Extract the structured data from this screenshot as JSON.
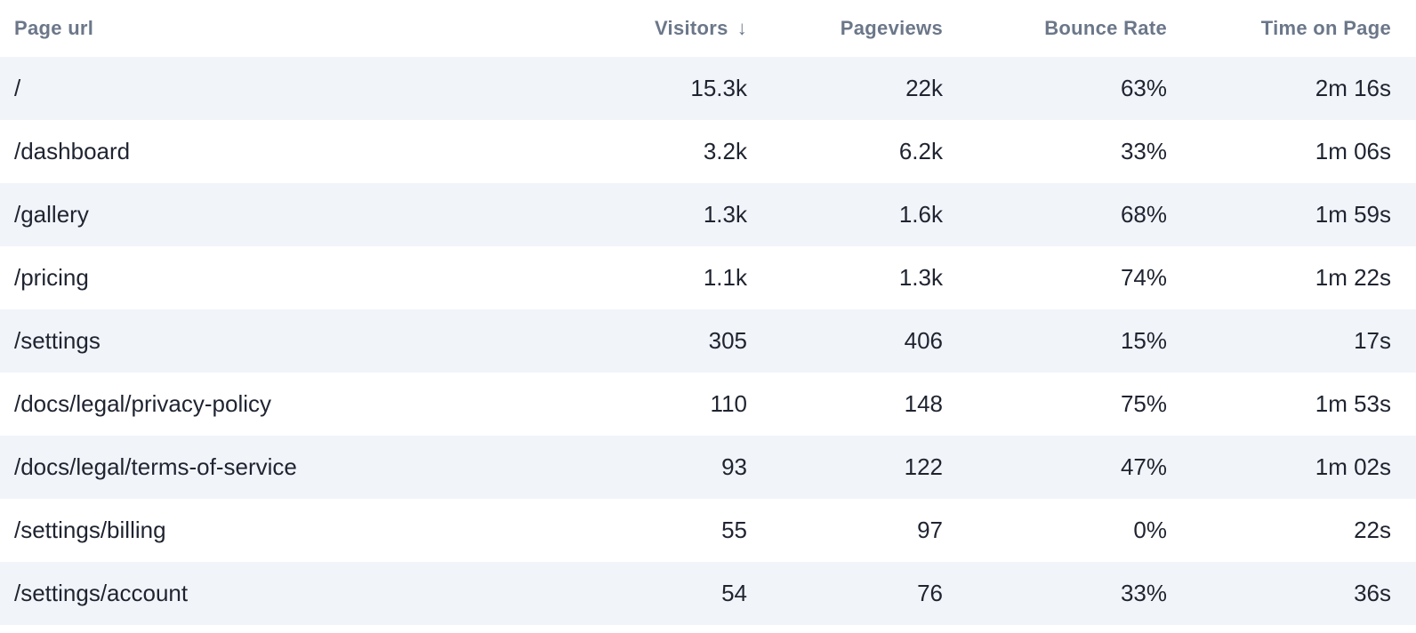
{
  "table": {
    "headers": {
      "page_url": "Page url",
      "visitors": "Visitors",
      "visitors_sort_icon": "↓",
      "pageviews": "Pageviews",
      "bounce_rate": "Bounce Rate",
      "time_on_page": "Time on Page"
    },
    "rows": [
      {
        "url": "/",
        "visitors": "15.3k",
        "pageviews": "22k",
        "bounce_rate": "63%",
        "time_on_page": "2m 16s"
      },
      {
        "url": "/dashboard",
        "visitors": "3.2k",
        "pageviews": "6.2k",
        "bounce_rate": "33%",
        "time_on_page": "1m 06s"
      },
      {
        "url": "/gallery",
        "visitors": "1.3k",
        "pageviews": "1.6k",
        "bounce_rate": "68%",
        "time_on_page": "1m 59s"
      },
      {
        "url": "/pricing",
        "visitors": "1.1k",
        "pageviews": "1.3k",
        "bounce_rate": "74%",
        "time_on_page": "1m 22s"
      },
      {
        "url": "/settings",
        "visitors": "305",
        "pageviews": "406",
        "bounce_rate": "15%",
        "time_on_page": "17s"
      },
      {
        "url": "/docs/legal/privacy-policy",
        "visitors": "110",
        "pageviews": "148",
        "bounce_rate": "75%",
        "time_on_page": "1m 53s"
      },
      {
        "url": "/docs/legal/terms-of-service",
        "visitors": "93",
        "pageviews": "122",
        "bounce_rate": "47%",
        "time_on_page": "1m 02s"
      },
      {
        "url": "/settings/billing",
        "visitors": "55",
        "pageviews": "97",
        "bounce_rate": "0%",
        "time_on_page": "22s"
      },
      {
        "url": "/settings/account",
        "visitors": "54",
        "pageviews": "76",
        "bounce_rate": "33%",
        "time_on_page": "36s"
      }
    ]
  },
  "colors": {
    "header_text": "#6b7789",
    "body_text": "#1f2430",
    "stripe_background": "#f1f4f9",
    "background": "#ffffff"
  }
}
